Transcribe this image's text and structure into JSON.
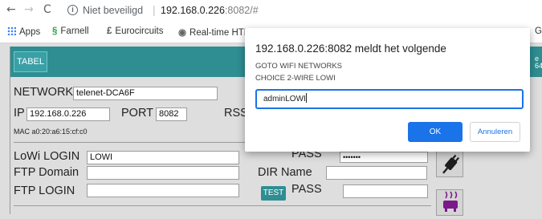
{
  "browser": {
    "security_label": "Niet beveiligd",
    "url_host": "192.168.0.226",
    "url_rest": ":8082/#",
    "bookmarks": [
      "Apps",
      "Farnell",
      "Eurocircuits",
      "Real-time HTML"
    ],
    "bookmarks_right": "G"
  },
  "app": {
    "tabel_label": "TABEL",
    "header_right_1": "e",
    "header_right_2": "64",
    "network_label": "NETWORK",
    "network_value": "telenet-DCA6F",
    "ip_label": "IP",
    "ip_value": "192.168.0.226",
    "port_label": "PORT",
    "port_value": "8082",
    "rssi_label": "RSS",
    "mac_label": "MAC",
    "mac_value": "a0:20:a6:15:cf:c0",
    "lowi_login_label": "LoWi LOGIN",
    "lowi_login_value": "LOWI",
    "pass_label": "PASS",
    "pass_value": "•••••••",
    "ftp_domain_label": "FTP Domain",
    "dir_name_label": "DIR Name",
    "ftp_login_label": "FTP LOGIN",
    "test_label": "TEST",
    "pass2_label": "PASS"
  },
  "dialog": {
    "title": "192.168.0.226:8082 meldt het volgende",
    "message_line1": "GOTO WIFI NETWORKS",
    "message_line2": "CHOICE 2-WIRE LOWI",
    "input_value": "adminLOWI",
    "ok_label": "OK",
    "cancel_label": "Annuleren"
  },
  "colors": {
    "header_teal": "#2e8e92",
    "accent_blue": "#1a73e8"
  }
}
